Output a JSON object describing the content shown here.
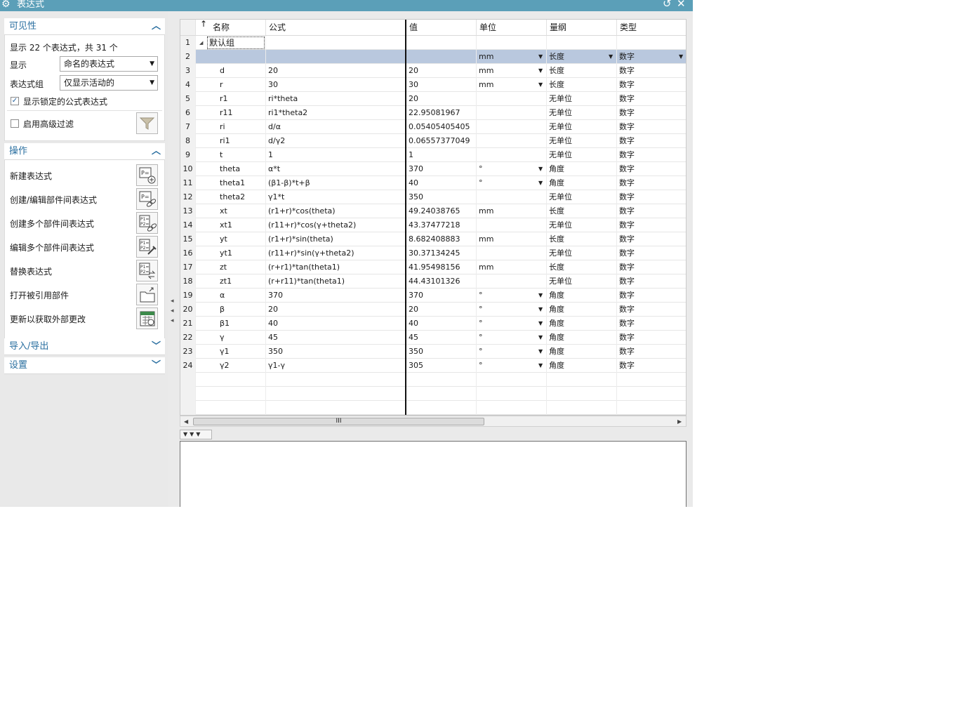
{
  "window": {
    "title": "表达式",
    "refresh_glyph": "↺",
    "close_glyph": "✕"
  },
  "visibility": {
    "header": "可见性",
    "summary": "显示 22 个表达式，共 31 个",
    "display_label": "显示",
    "display_value": "命名的表达式",
    "group_label": "表达式组",
    "group_value": "仅显示活动的",
    "show_locked_label": "显示锁定的公式表达式",
    "show_locked_checked": true,
    "advanced_filter_label": "启用高级过滤",
    "advanced_filter_checked": false
  },
  "operations": {
    "header": "操作",
    "items": [
      {
        "label": "新建表达式",
        "icon": "new-expression-icon"
      },
      {
        "label": "创建/编辑部件间表达式",
        "icon": "interpart-link-icon"
      },
      {
        "label": "创建多个部件间表达式",
        "icon": "multi-interpart-icon"
      },
      {
        "label": "编辑多个部件间表达式",
        "icon": "edit-multi-interpart-icon"
      },
      {
        "label": "替换表达式",
        "icon": "replace-expression-icon"
      },
      {
        "label": "打开被引用部件",
        "icon": "open-referenced-part-icon"
      },
      {
        "label": "更新以获取外部更改",
        "icon": "update-external-icon"
      }
    ]
  },
  "import_export": {
    "header": "导入/导出"
  },
  "settings": {
    "header": "设置"
  },
  "grid": {
    "sort_glyph": "↑",
    "columns": [
      "名称",
      "公式",
      "值",
      "单位",
      "量纲",
      "类型"
    ],
    "group_row": "默认组",
    "rows": [
      {
        "n": "1",
        "name": "",
        "formula": "",
        "value": "",
        "unit": "",
        "dim": "",
        "type": "",
        "group": true
      },
      {
        "n": "2",
        "name": "",
        "formula": "",
        "value": "",
        "unit": "mm",
        "dim": "长度",
        "type": "数字",
        "selected": true,
        "unit_dd": true,
        "dim_dd": true,
        "type_dd": true
      },
      {
        "n": "3",
        "name": "d",
        "formula": "20",
        "value": "20",
        "unit": "mm",
        "dim": "长度",
        "type": "数字",
        "unit_dd": true
      },
      {
        "n": "4",
        "name": "r",
        "formula": "30",
        "value": "30",
        "unit": "mm",
        "dim": "长度",
        "type": "数字",
        "unit_dd": true
      },
      {
        "n": "5",
        "name": "r1",
        "formula": "ri*theta",
        "value": "20",
        "unit": "",
        "dim": "无单位",
        "type": "数字"
      },
      {
        "n": "6",
        "name": "r11",
        "formula": "ri1*theta2",
        "value": "22.95081967",
        "unit": "",
        "dim": "无单位",
        "type": "数字"
      },
      {
        "n": "7",
        "name": "ri",
        "formula": "d/α",
        "value": "0.05405405405",
        "unit": "",
        "dim": "无单位",
        "type": "数字"
      },
      {
        "n": "8",
        "name": "ri1",
        "formula": "d/γ2",
        "value": "0.06557377049",
        "unit": "",
        "dim": "无单位",
        "type": "数字"
      },
      {
        "n": "9",
        "name": "t",
        "formula": "1",
        "value": "1",
        "unit": "",
        "dim": "无单位",
        "type": "数字"
      },
      {
        "n": "10",
        "name": "theta",
        "formula": "α*t",
        "value": "370",
        "unit": "°",
        "dim": "角度",
        "type": "数字",
        "unit_dd": true
      },
      {
        "n": "11",
        "name": "theta1",
        "formula": "(β1-β)*t+β",
        "value": "40",
        "unit": "°",
        "dim": "角度",
        "type": "数字",
        "unit_dd": true
      },
      {
        "n": "12",
        "name": "theta2",
        "formula": "γ1*t",
        "value": "350",
        "unit": "",
        "dim": "无单位",
        "type": "数字"
      },
      {
        "n": "13",
        "name": "xt",
        "formula": "(r1+r)*cos(theta)",
        "value": "49.24038765",
        "unit": "mm",
        "dim": "长度",
        "type": "数字"
      },
      {
        "n": "14",
        "name": "xt1",
        "formula": "(r11+r)*cos(γ+theta2)",
        "value": "43.37477218",
        "unit": "",
        "dim": "无单位",
        "type": "数字"
      },
      {
        "n": "15",
        "name": "yt",
        "formula": "(r1+r)*sin(theta)",
        "value": "8.682408883",
        "unit": "mm",
        "dim": "长度",
        "type": "数字"
      },
      {
        "n": "16",
        "name": "yt1",
        "formula": "(r11+r)*sin(γ+theta2)",
        "value": "30.37134245",
        "unit": "",
        "dim": "无单位",
        "type": "数字"
      },
      {
        "n": "17",
        "name": "zt",
        "formula": "(r+r1)*tan(theta1)",
        "value": "41.95498156",
        "unit": "mm",
        "dim": "长度",
        "type": "数字"
      },
      {
        "n": "18",
        "name": "zt1",
        "formula": "(r+r11)*tan(theta1)",
        "value": "44.43101326",
        "unit": "",
        "dim": "无单位",
        "type": "数字"
      },
      {
        "n": "19",
        "name": "α",
        "formula": "370",
        "value": "370",
        "unit": "°",
        "dim": "角度",
        "type": "数字",
        "unit_dd": true
      },
      {
        "n": "20",
        "name": "β",
        "formula": "20",
        "value": "20",
        "unit": "°",
        "dim": "角度",
        "type": "数字",
        "unit_dd": true
      },
      {
        "n": "21",
        "name": "β1",
        "formula": "40",
        "value": "40",
        "unit": "°",
        "dim": "角度",
        "type": "数字",
        "unit_dd": true
      },
      {
        "n": "22",
        "name": "γ",
        "formula": "45",
        "value": "45",
        "unit": "°",
        "dim": "角度",
        "type": "数字",
        "unit_dd": true
      },
      {
        "n": "23",
        "name": "γ1",
        "formula": "350",
        "value": "350",
        "unit": "°",
        "dim": "角度",
        "type": "数字",
        "unit_dd": true
      },
      {
        "n": "24",
        "name": "γ2",
        "formula": "γ1-γ",
        "value": "305",
        "unit": "°",
        "dim": "角度",
        "type": "数字",
        "unit_dd": true
      }
    ]
  },
  "scrollbar": {
    "thumb_grip": "III"
  },
  "colors": {
    "titlebar": "#5b9fb8",
    "accent_text": "#2a6fa0",
    "selected_row": "#b9c8de"
  }
}
